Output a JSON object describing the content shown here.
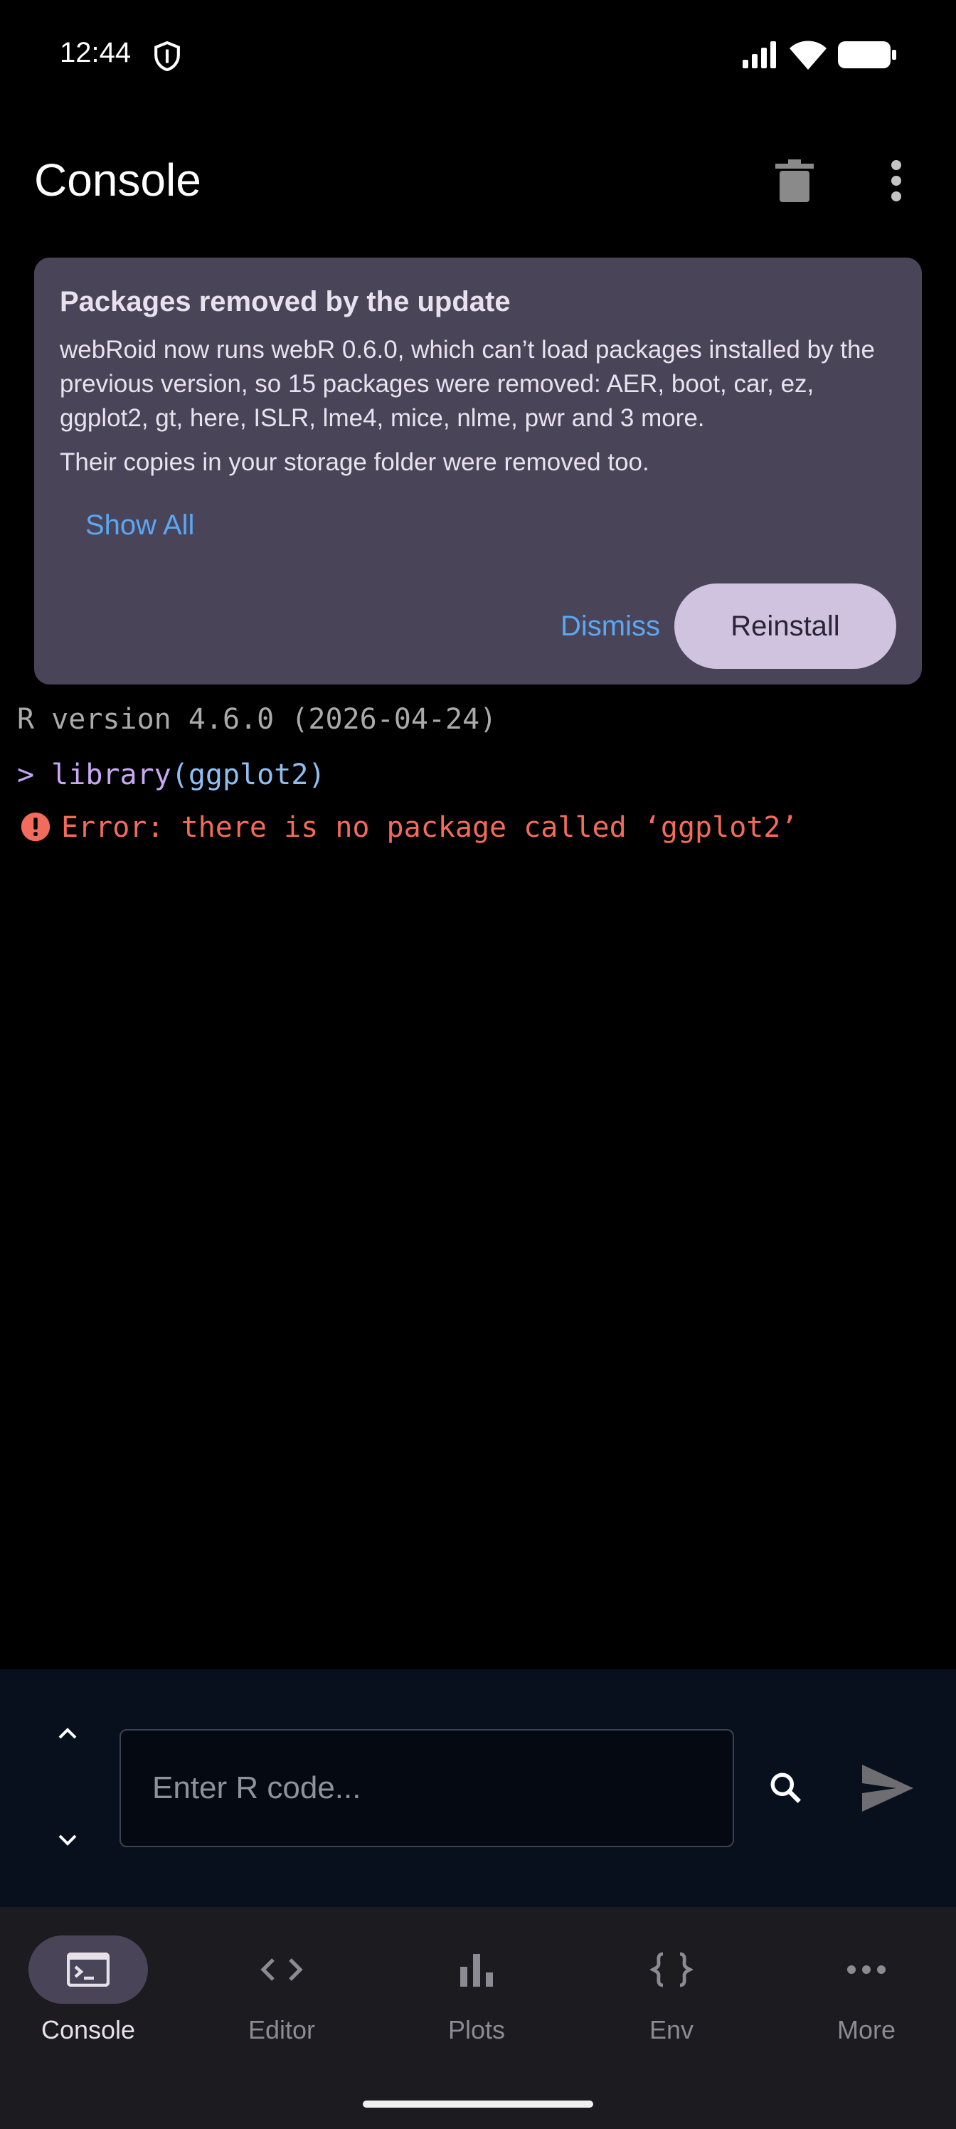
{
  "status_bar": {
    "time": "12:44",
    "icons": [
      "shield-icon",
      "signal-icon",
      "wifi-icon",
      "battery-icon"
    ]
  },
  "app_bar": {
    "title": "Console",
    "actions": [
      "trash-icon",
      "overflow-menu-icon"
    ]
  },
  "banner": {
    "title": "Packages removed by the update",
    "body": "webRoid now runs webR 0.6.0, which can’t load packages installed by the previous version, so 15 packages were removed: AER, boot, car, ez, ggplot2, gt, here, ISLR, lme4, mice, nlme, pwr and 3 more.",
    "body2": "Their copies in your storage folder were removed too.",
    "show_all_label": "Show All",
    "dismiss_label": "Dismiss",
    "reinstall_label": "Reinstall"
  },
  "console": {
    "version_line": "R version 4.6.0 (2026-04-24)",
    "prompt": "> ",
    "command_fn": "library",
    "command_args": "(ggplot2)",
    "error": "Error: there is no package called ‘ggplot2’"
  },
  "input": {
    "placeholder": "Enter R code...",
    "value": ""
  },
  "nav": {
    "items": [
      {
        "label": "Console",
        "icon": "terminal-icon",
        "active": true
      },
      {
        "label": "Editor",
        "icon": "code-icon",
        "active": false
      },
      {
        "label": "Plots",
        "icon": "bar-chart-icon",
        "active": false
      },
      {
        "label": "Env",
        "icon": "braces-icon",
        "active": false
      },
      {
        "label": "More",
        "icon": "more-horiz-icon",
        "active": false
      }
    ]
  },
  "colors": {
    "banner_bg": "#4a4458",
    "accent_link": "#5aa7f5",
    "error": "#f26b5b",
    "reinstall_bg": "#cfc3df"
  }
}
